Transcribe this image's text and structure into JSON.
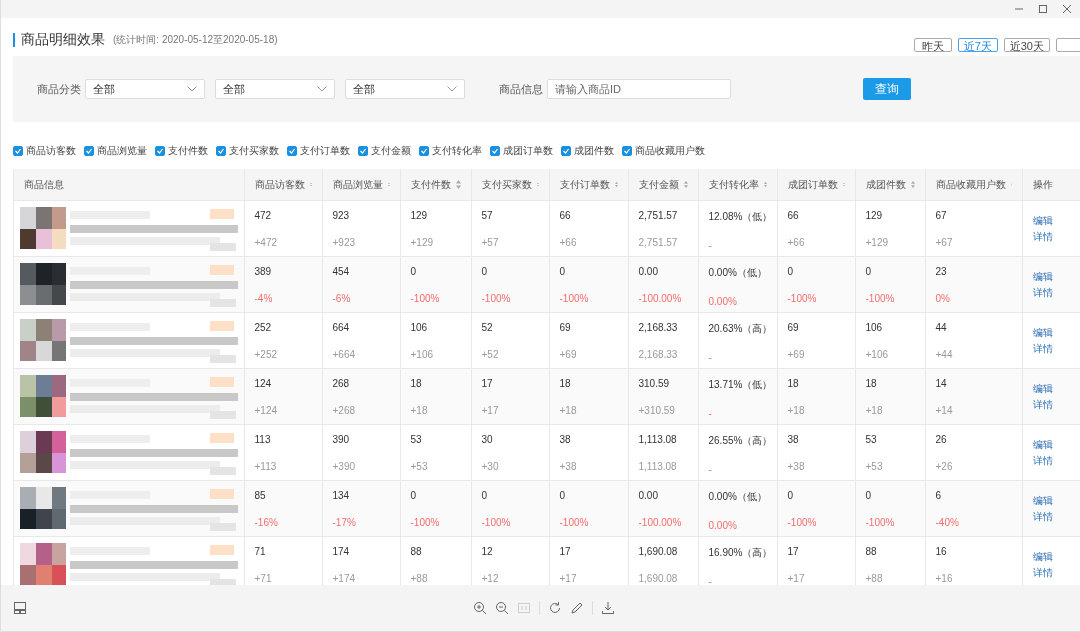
{
  "page_title": "商品明细效果",
  "stat_period": "(统计时间: 2020-05-12至2020-05-18)",
  "range_buttons": [
    {
      "label": "昨天",
      "selected": false
    },
    {
      "label": "近7天",
      "selected": true
    },
    {
      "label": "近30天",
      "selected": false
    },
    {
      "selected": false
    }
  ],
  "filters": {
    "category_label": "商品分类",
    "category_selects": [
      "全部",
      "全部",
      "全部"
    ],
    "info_label": "商品信息",
    "info_placeholder": "请输入商品ID",
    "query_button": "查询"
  },
  "metric_toggles": [
    {
      "label": "商品访客数",
      "checked": true
    },
    {
      "label": "商品浏览量",
      "checked": true
    },
    {
      "label": "支付件数",
      "checked": true
    },
    {
      "label": "支付买家数",
      "checked": true
    },
    {
      "label": "支付订单数",
      "checked": true
    },
    {
      "label": "支付金额",
      "checked": true
    },
    {
      "label": "支付转化率",
      "checked": true
    },
    {
      "label": "成团订单数",
      "checked": true
    },
    {
      "label": "成团件数",
      "checked": true
    },
    {
      "label": "商品收藏用户数",
      "checked": true
    }
  ],
  "table": {
    "columns": [
      {
        "label": "商品信息",
        "sortable": false
      },
      {
        "label": "商品访客数",
        "sortable": true
      },
      {
        "label": "商品浏览量",
        "sortable": true
      },
      {
        "label": "支付件数",
        "sortable": true
      },
      {
        "label": "支付买家数",
        "sortable": true
      },
      {
        "label": "支付订单数",
        "sortable": true
      },
      {
        "label": "支付金额",
        "sortable": true
      },
      {
        "label": "支付转化率",
        "sortable": true
      },
      {
        "label": "成团订单数",
        "sortable": true
      },
      {
        "label": "成团件数",
        "sortable": true
      },
      {
        "label": "商品收藏用户数",
        "sortable": true
      },
      {
        "label": "操作",
        "sortable": false
      }
    ],
    "rows": [
      {
        "cells": [
          {
            "kind": "picture"
          },
          {
            "kind": "metric",
            "value": "472",
            "change": "+472",
            "alert": false
          },
          {
            "kind": "metric",
            "value": "923",
            "change": "+923",
            "alert": false
          },
          {
            "kind": "metric",
            "value": "129",
            "change": "+129",
            "alert": false
          },
          {
            "kind": "metric",
            "value": "57",
            "change": "+57",
            "alert": false
          },
          {
            "kind": "metric",
            "value": "66",
            "change": "+66",
            "alert": false
          },
          {
            "kind": "metric",
            "value": "2,751.57",
            "change": "2,751.57",
            "alert": false
          },
          {
            "kind": "metric",
            "value": "12.08%（低）",
            "change": "-",
            "alert": true
          },
          {
            "kind": "metric",
            "value": "66",
            "change": "+66",
            "alert": false
          },
          {
            "kind": "metric",
            "value": "129",
            "change": "+129",
            "alert": false
          },
          {
            "kind": "metric",
            "value": "67",
            "change": "+67",
            "alert": false
          },
          {
            "kind": "actions",
            "links": [
              "编辑",
              "详情"
            ]
          }
        ]
      },
      {
        "cells": [
          {
            "kind": "picture"
          },
          {
            "kind": "metric",
            "value": "389",
            "change": "-4%",
            "alert": true
          },
          {
            "kind": "metric",
            "value": "454",
            "change": "-6%",
            "alert": true
          },
          {
            "kind": "metric",
            "value": "0",
            "change": "-100%",
            "alert": true
          },
          {
            "kind": "metric",
            "value": "0",
            "change": "-100%",
            "alert": true
          },
          {
            "kind": "metric",
            "value": "0",
            "change": "-100%",
            "alert": true
          },
          {
            "kind": "metric",
            "value": "0.00",
            "change": "-100.00%",
            "alert": true
          },
          {
            "kind": "metric",
            "value": "0.00%（低）",
            "change": "0.00%",
            "alert": true
          },
          {
            "kind": "metric",
            "value": "0",
            "change": "-100%",
            "alert": true
          },
          {
            "kind": "metric",
            "value": "0",
            "change": "-100%",
            "alert": true
          },
          {
            "kind": "metric",
            "value": "23",
            "change": "0%",
            "alert": true
          },
          {
            "kind": "actions",
            "links": [
              "编辑",
              "详情"
            ]
          }
        ]
      },
      {
        "cells": [
          {
            "kind": "picture"
          },
          {
            "kind": "metric",
            "value": "252",
            "change": "+252",
            "alert": false
          },
          {
            "kind": "metric",
            "value": "664",
            "change": "+664",
            "alert": false
          },
          {
            "kind": "metric",
            "value": "106",
            "change": "+106",
            "alert": false
          },
          {
            "kind": "metric",
            "value": "52",
            "change": "+52",
            "alert": false
          },
          {
            "kind": "metric",
            "value": "69",
            "change": "+69",
            "alert": false
          },
          {
            "kind": "metric",
            "value": "2,168.33",
            "change": "2,168.33",
            "alert": false
          },
          {
            "kind": "metric",
            "value": "20.63%（高）",
            "change": "-",
            "alert": true
          },
          {
            "kind": "metric",
            "value": "69",
            "change": "+69",
            "alert": false
          },
          {
            "kind": "metric",
            "value": "106",
            "change": "+106",
            "alert": false
          },
          {
            "kind": "metric",
            "value": "44",
            "change": "+44",
            "alert": false
          },
          {
            "kind": "actions",
            "links": [
              "编辑",
              "详情"
            ]
          }
        ]
      },
      {
        "cells": [
          {
            "kind": "picture"
          },
          {
            "kind": "metric",
            "value": "124",
            "change": "+124",
            "alert": false
          },
          {
            "kind": "metric",
            "value": "268",
            "change": "+268",
            "alert": false
          },
          {
            "kind": "metric",
            "value": "18",
            "change": "+18",
            "alert": false
          },
          {
            "kind": "metric",
            "value": "17",
            "change": "+17",
            "alert": false
          },
          {
            "kind": "metric",
            "value": "18",
            "change": "+18",
            "alert": false
          },
          {
            "kind": "metric",
            "value": "310.59",
            "change": "+310.59",
            "alert": false
          },
          {
            "kind": "metric",
            "value": "13.71%（低）",
            "change": "-",
            "alert": true
          },
          {
            "kind": "metric",
            "value": "18",
            "change": "+18",
            "alert": false
          },
          {
            "kind": "metric",
            "value": "18",
            "change": "+18",
            "alert": false
          },
          {
            "kind": "metric",
            "value": "14",
            "change": "+14",
            "alert": false
          },
          {
            "kind": "actions",
            "links": [
              "编辑",
              "详情"
            ]
          }
        ]
      },
      {
        "cells": [
          {
            "kind": "picture"
          },
          {
            "kind": "metric",
            "value": "113",
            "change": "+113",
            "alert": false
          },
          {
            "kind": "metric",
            "value": "390",
            "change": "+390",
            "alert": false
          },
          {
            "kind": "metric",
            "value": "53",
            "change": "+53",
            "alert": false
          },
          {
            "kind": "metric",
            "value": "30",
            "change": "+30",
            "alert": false
          },
          {
            "kind": "metric",
            "value": "38",
            "change": "+38",
            "alert": false
          },
          {
            "kind": "metric",
            "value": "1,113.08",
            "change": "1,113.08",
            "alert": false
          },
          {
            "kind": "metric",
            "value": "26.55%（高）",
            "change": "-",
            "alert": true
          },
          {
            "kind": "metric",
            "value": "38",
            "change": "+38",
            "alert": false
          },
          {
            "kind": "metric",
            "value": "53",
            "change": "+53",
            "alert": false
          },
          {
            "kind": "metric",
            "value": "26",
            "change": "+26",
            "alert": false
          },
          {
            "kind": "actions",
            "links": [
              "编辑",
              "详情"
            ]
          }
        ]
      },
      {
        "cells": [
          {
            "kind": "picture"
          },
          {
            "kind": "metric",
            "value": "85",
            "change": "-16%",
            "alert": true
          },
          {
            "kind": "metric",
            "value": "134",
            "change": "-17%",
            "alert": true
          },
          {
            "kind": "metric",
            "value": "0",
            "change": "-100%",
            "alert": true
          },
          {
            "kind": "metric",
            "value": "0",
            "change": "-100%",
            "alert": true
          },
          {
            "kind": "metric",
            "value": "0",
            "change": "-100%",
            "alert": true
          },
          {
            "kind": "metric",
            "value": "0.00",
            "change": "-100.00%",
            "alert": true
          },
          {
            "kind": "metric",
            "value": "0.00%（低）",
            "change": "0.00%",
            "alert": true
          },
          {
            "kind": "metric",
            "value": "0",
            "change": "-100%",
            "alert": true
          },
          {
            "kind": "metric",
            "value": "0",
            "change": "-100%",
            "alert": true
          },
          {
            "kind": "metric",
            "value": "6",
            "change": "-40%",
            "alert": true
          },
          {
            "kind": "actions",
            "links": [
              "编辑",
              "详情"
            ]
          }
        ]
      },
      {
        "cells": [
          {
            "kind": "picture"
          },
          {
            "kind": "metric",
            "value": "71",
            "change": "+71",
            "alert": false
          },
          {
            "kind": "metric",
            "value": "174",
            "change": "+174",
            "alert": false
          },
          {
            "kind": "metric",
            "value": "88",
            "change": "+88",
            "alert": false
          },
          {
            "kind": "metric",
            "value": "12",
            "change": "+12",
            "alert": false
          },
          {
            "kind": "metric",
            "value": "17",
            "change": "+17",
            "alert": false
          },
          {
            "kind": "metric",
            "value": "1,690.08",
            "change": "1,690.08",
            "alert": false
          },
          {
            "kind": "metric",
            "value": "16.90%（高）",
            "change": "-",
            "alert": true
          },
          {
            "kind": "metric",
            "value": "17",
            "change": "+17",
            "alert": false
          },
          {
            "kind": "metric",
            "value": "88",
            "change": "+88",
            "alert": false
          },
          {
            "kind": "metric",
            "value": "16",
            "change": "+16",
            "alert": false
          },
          {
            "kind": "actions",
            "links": [
              "编辑",
              "详情"
            ]
          }
        ]
      }
    ]
  }
}
